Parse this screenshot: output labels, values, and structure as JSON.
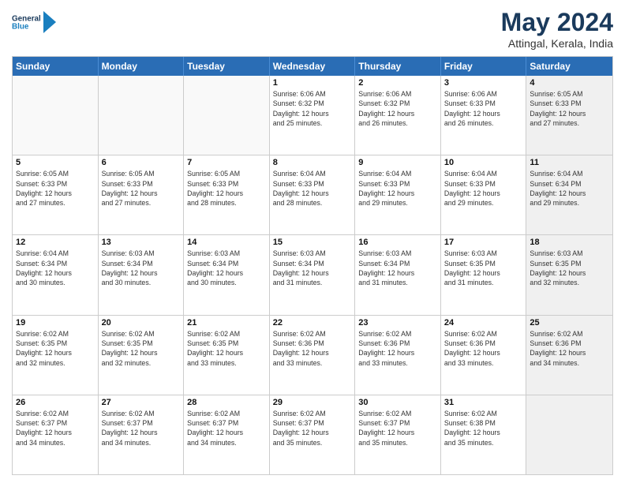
{
  "logo": {
    "line1": "General",
    "line2": "Blue"
  },
  "title": "May 2024",
  "location": "Attingal, Kerala, India",
  "days_of_week": [
    "Sunday",
    "Monday",
    "Tuesday",
    "Wednesday",
    "Thursday",
    "Friday",
    "Saturday"
  ],
  "weeks": [
    [
      {
        "day": "",
        "info": "",
        "shaded": false,
        "empty": true
      },
      {
        "day": "",
        "info": "",
        "shaded": false,
        "empty": true
      },
      {
        "day": "",
        "info": "",
        "shaded": false,
        "empty": true
      },
      {
        "day": "1",
        "info": "Sunrise: 6:06 AM\nSunset: 6:32 PM\nDaylight: 12 hours\nand 25 minutes.",
        "shaded": false,
        "empty": false
      },
      {
        "day": "2",
        "info": "Sunrise: 6:06 AM\nSunset: 6:32 PM\nDaylight: 12 hours\nand 26 minutes.",
        "shaded": false,
        "empty": false
      },
      {
        "day": "3",
        "info": "Sunrise: 6:06 AM\nSunset: 6:33 PM\nDaylight: 12 hours\nand 26 minutes.",
        "shaded": false,
        "empty": false
      },
      {
        "day": "4",
        "info": "Sunrise: 6:05 AM\nSunset: 6:33 PM\nDaylight: 12 hours\nand 27 minutes.",
        "shaded": true,
        "empty": false
      }
    ],
    [
      {
        "day": "5",
        "info": "Sunrise: 6:05 AM\nSunset: 6:33 PM\nDaylight: 12 hours\nand 27 minutes.",
        "shaded": false,
        "empty": false
      },
      {
        "day": "6",
        "info": "Sunrise: 6:05 AM\nSunset: 6:33 PM\nDaylight: 12 hours\nand 27 minutes.",
        "shaded": false,
        "empty": false
      },
      {
        "day": "7",
        "info": "Sunrise: 6:05 AM\nSunset: 6:33 PM\nDaylight: 12 hours\nand 28 minutes.",
        "shaded": false,
        "empty": false
      },
      {
        "day": "8",
        "info": "Sunrise: 6:04 AM\nSunset: 6:33 PM\nDaylight: 12 hours\nand 28 minutes.",
        "shaded": false,
        "empty": false
      },
      {
        "day": "9",
        "info": "Sunrise: 6:04 AM\nSunset: 6:33 PM\nDaylight: 12 hours\nand 29 minutes.",
        "shaded": false,
        "empty": false
      },
      {
        "day": "10",
        "info": "Sunrise: 6:04 AM\nSunset: 6:33 PM\nDaylight: 12 hours\nand 29 minutes.",
        "shaded": false,
        "empty": false
      },
      {
        "day": "11",
        "info": "Sunrise: 6:04 AM\nSunset: 6:34 PM\nDaylight: 12 hours\nand 29 minutes.",
        "shaded": true,
        "empty": false
      }
    ],
    [
      {
        "day": "12",
        "info": "Sunrise: 6:04 AM\nSunset: 6:34 PM\nDaylight: 12 hours\nand 30 minutes.",
        "shaded": false,
        "empty": false
      },
      {
        "day": "13",
        "info": "Sunrise: 6:03 AM\nSunset: 6:34 PM\nDaylight: 12 hours\nand 30 minutes.",
        "shaded": false,
        "empty": false
      },
      {
        "day": "14",
        "info": "Sunrise: 6:03 AM\nSunset: 6:34 PM\nDaylight: 12 hours\nand 30 minutes.",
        "shaded": false,
        "empty": false
      },
      {
        "day": "15",
        "info": "Sunrise: 6:03 AM\nSunset: 6:34 PM\nDaylight: 12 hours\nand 31 minutes.",
        "shaded": false,
        "empty": false
      },
      {
        "day": "16",
        "info": "Sunrise: 6:03 AM\nSunset: 6:34 PM\nDaylight: 12 hours\nand 31 minutes.",
        "shaded": false,
        "empty": false
      },
      {
        "day": "17",
        "info": "Sunrise: 6:03 AM\nSunset: 6:35 PM\nDaylight: 12 hours\nand 31 minutes.",
        "shaded": false,
        "empty": false
      },
      {
        "day": "18",
        "info": "Sunrise: 6:03 AM\nSunset: 6:35 PM\nDaylight: 12 hours\nand 32 minutes.",
        "shaded": true,
        "empty": false
      }
    ],
    [
      {
        "day": "19",
        "info": "Sunrise: 6:02 AM\nSunset: 6:35 PM\nDaylight: 12 hours\nand 32 minutes.",
        "shaded": false,
        "empty": false
      },
      {
        "day": "20",
        "info": "Sunrise: 6:02 AM\nSunset: 6:35 PM\nDaylight: 12 hours\nand 32 minutes.",
        "shaded": false,
        "empty": false
      },
      {
        "day": "21",
        "info": "Sunrise: 6:02 AM\nSunset: 6:35 PM\nDaylight: 12 hours\nand 33 minutes.",
        "shaded": false,
        "empty": false
      },
      {
        "day": "22",
        "info": "Sunrise: 6:02 AM\nSunset: 6:36 PM\nDaylight: 12 hours\nand 33 minutes.",
        "shaded": false,
        "empty": false
      },
      {
        "day": "23",
        "info": "Sunrise: 6:02 AM\nSunset: 6:36 PM\nDaylight: 12 hours\nand 33 minutes.",
        "shaded": false,
        "empty": false
      },
      {
        "day": "24",
        "info": "Sunrise: 6:02 AM\nSunset: 6:36 PM\nDaylight: 12 hours\nand 33 minutes.",
        "shaded": false,
        "empty": false
      },
      {
        "day": "25",
        "info": "Sunrise: 6:02 AM\nSunset: 6:36 PM\nDaylight: 12 hours\nand 34 minutes.",
        "shaded": true,
        "empty": false
      }
    ],
    [
      {
        "day": "26",
        "info": "Sunrise: 6:02 AM\nSunset: 6:37 PM\nDaylight: 12 hours\nand 34 minutes.",
        "shaded": false,
        "empty": false
      },
      {
        "day": "27",
        "info": "Sunrise: 6:02 AM\nSunset: 6:37 PM\nDaylight: 12 hours\nand 34 minutes.",
        "shaded": false,
        "empty": false
      },
      {
        "day": "28",
        "info": "Sunrise: 6:02 AM\nSunset: 6:37 PM\nDaylight: 12 hours\nand 34 minutes.",
        "shaded": false,
        "empty": false
      },
      {
        "day": "29",
        "info": "Sunrise: 6:02 AM\nSunset: 6:37 PM\nDaylight: 12 hours\nand 35 minutes.",
        "shaded": false,
        "empty": false
      },
      {
        "day": "30",
        "info": "Sunrise: 6:02 AM\nSunset: 6:37 PM\nDaylight: 12 hours\nand 35 minutes.",
        "shaded": false,
        "empty": false
      },
      {
        "day": "31",
        "info": "Sunrise: 6:02 AM\nSunset: 6:38 PM\nDaylight: 12 hours\nand 35 minutes.",
        "shaded": false,
        "empty": false
      },
      {
        "day": "",
        "info": "",
        "shaded": true,
        "empty": true
      }
    ]
  ]
}
